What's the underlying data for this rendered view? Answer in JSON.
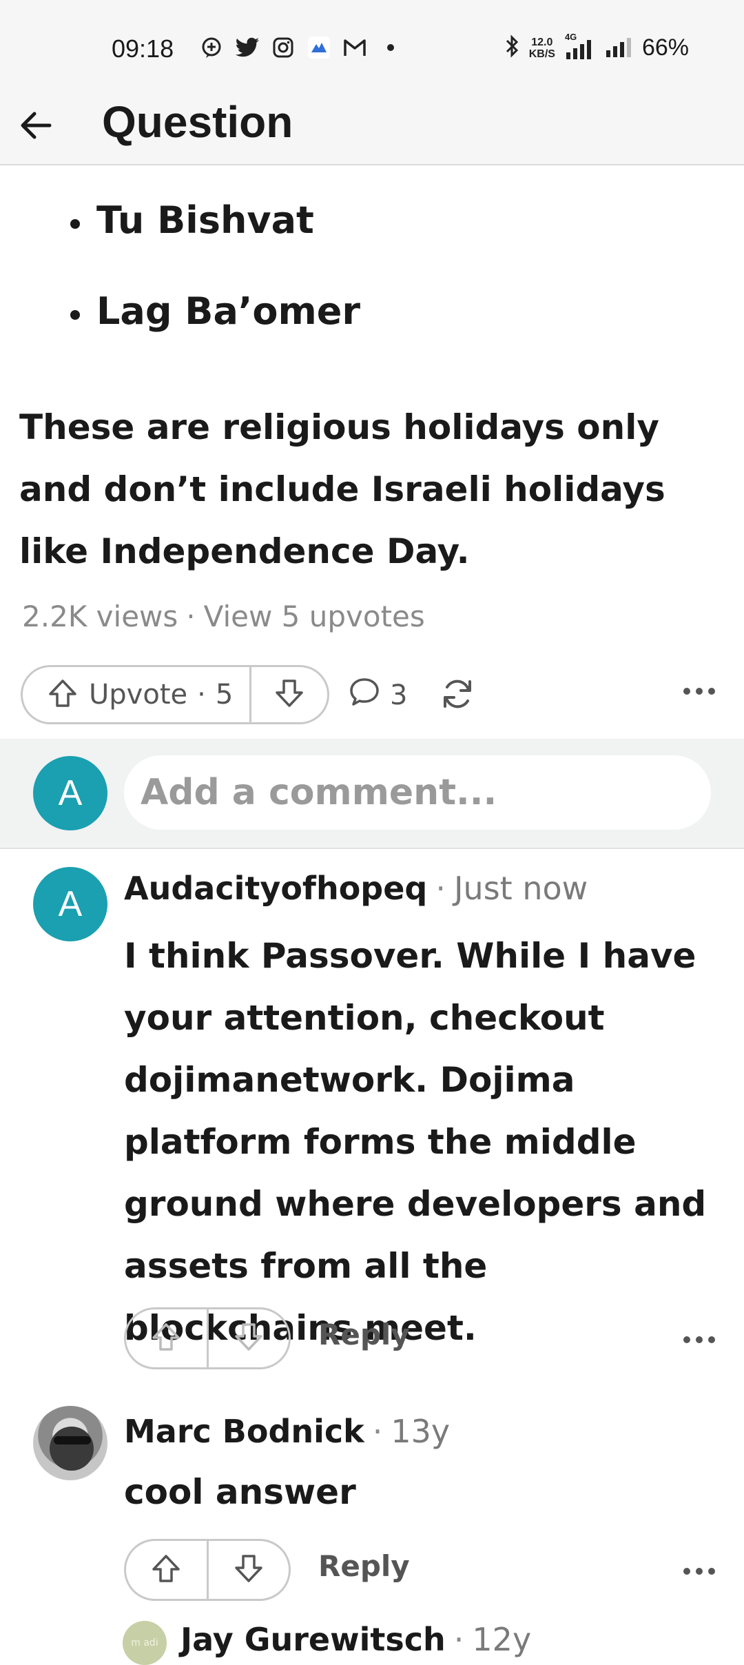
{
  "status_bar": {
    "time": "09:18",
    "speed_value": "12.0",
    "speed_unit": "KB/S",
    "network": "4G",
    "battery": "66%",
    "app_icons": [
      "chat-plus-icon",
      "twitter-icon",
      "instagram-icon",
      "cloud-app-icon",
      "gmail-icon",
      "dot-icon"
    ]
  },
  "header": {
    "title": "Question"
  },
  "answer": {
    "bullets": [
      "Tu Bishvat",
      "Lag Ba’omer"
    ],
    "paragraph": "These are religious holidays only and don’t include Israeli holidays like Independence Day.",
    "views": "2.2K views",
    "view_upvotes": "View 5 upvotes",
    "upvote_label": "Upvote",
    "upvote_count": "5",
    "comment_count": "3"
  },
  "add_comment": {
    "avatar_letter": "A",
    "placeholder": "Add a comment..."
  },
  "comments": [
    {
      "avatar_letter": "A",
      "author": "Audacityofhopeq",
      "time": "Just now",
      "text": "I think Passover. While I have your attention, checkout dojimanetwork. Dojima platform forms the middle ground where developers and assets from all the blockchains meet.",
      "reply_label": "Reply"
    },
    {
      "author": "Marc Bodnick",
      "time": "13y",
      "text": "cool answer",
      "reply_label": "Reply"
    },
    {
      "author": "Jay Gurewitsch",
      "time": "12y",
      "avatar_text": "m adi"
    }
  ],
  "colors": {
    "accent_teal": "#1aa0b0",
    "muted_text": "#8a8a8a",
    "bar_bg": "#f6f6f6",
    "comment_band_bg": "#f1f2f2"
  }
}
